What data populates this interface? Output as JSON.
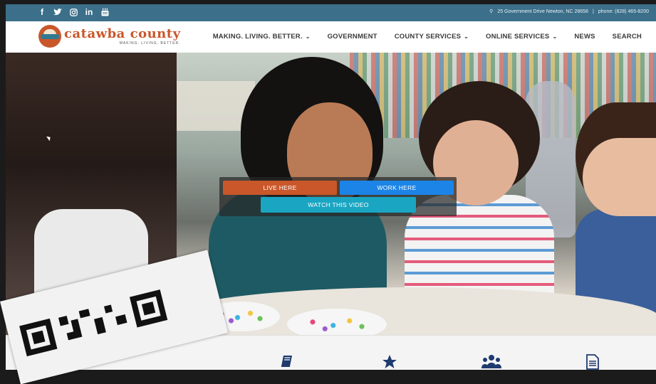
{
  "topbar": {
    "social": [
      {
        "icon": "facebook-icon",
        "glyph": "f"
      },
      {
        "icon": "twitter-icon",
        "glyph": "🐦"
      },
      {
        "icon": "instagram-icon",
        "glyph": "◎"
      },
      {
        "icon": "linkedin-icon",
        "glyph": "in"
      },
      {
        "icon": "youtube-icon",
        "glyph": "▤"
      }
    ],
    "address": "25 Government Drive Newton, NC 28658",
    "separator": "|",
    "phone": "phone: (828) 465-8200"
  },
  "logo": {
    "name": "catawba county",
    "tagline": "MAKING. LIVING. BETTER."
  },
  "nav": [
    {
      "label": "MAKING. LIVING. BETTER.",
      "dropdown": true
    },
    {
      "label": "GOVERNMENT",
      "dropdown": false
    },
    {
      "label": "COUNTY SERVICES",
      "dropdown": true
    },
    {
      "label": "ONLINE SERVICES",
      "dropdown": true
    },
    {
      "label": "NEWS",
      "dropdown": false
    },
    {
      "label": "SEARCH",
      "dropdown": false
    }
  ],
  "hero": {
    "live_label": "LIVE HERE",
    "work_label": "WORK HERE",
    "video_label": "WATCH THIS VIDEO"
  },
  "strip_icons": [
    "book-icon",
    "star-icon",
    "users-icon",
    "document-icon"
  ],
  "colors": {
    "brand_orange": "#c9572a",
    "topbar_blue": "#3b6f8a",
    "work_blue": "#1c84e6",
    "video_teal": "#1aa5c2",
    "icon_navy": "#1e3a6e"
  }
}
